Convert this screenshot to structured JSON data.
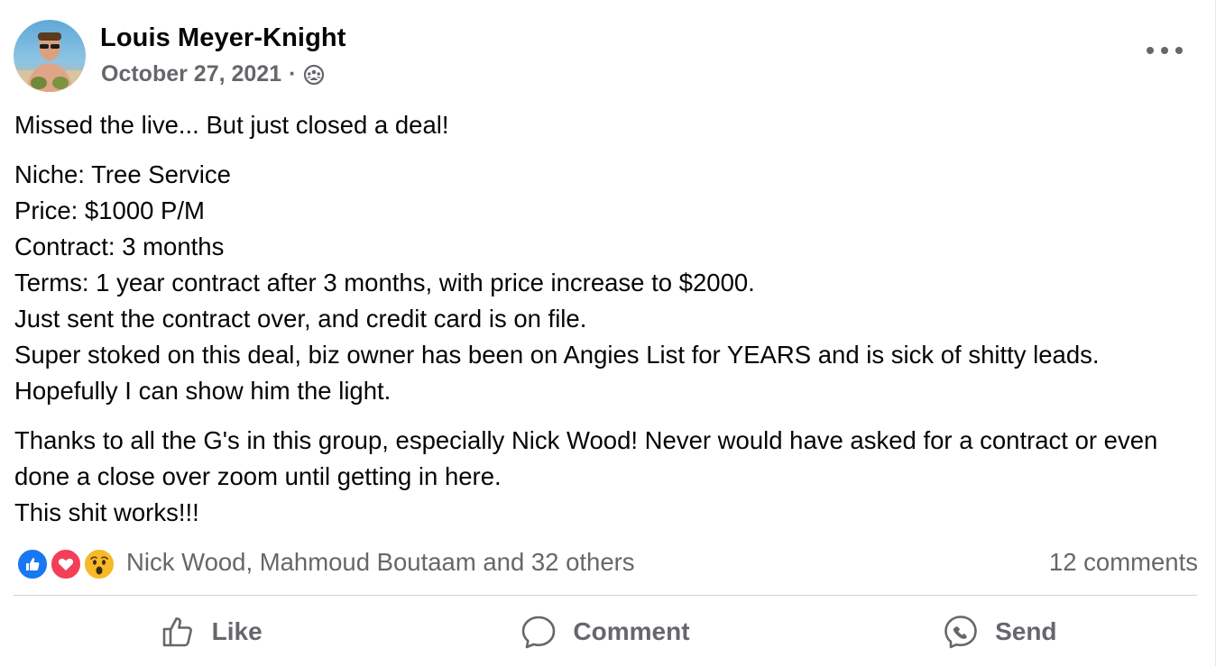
{
  "post": {
    "author": "Louis Meyer-Knight",
    "date": "October 27, 2021",
    "separator": "·",
    "privacy_icon": "group-audience-icon",
    "paragraphs": [
      [
        "Missed the live... But just closed a deal!"
      ],
      [
        "Niche: Tree Service",
        "Price: $1000 P/M",
        "Contract: 3 months",
        "Terms: 1 year contract after 3 months, with price increase to $2000.",
        "Just sent the contract over, and credit card is on file.",
        "Super stoked on this deal, biz owner has been on Angies List for YEARS and is sick of shitty leads. Hopefully I can show him the light."
      ],
      [
        "Thanks to all the G's in this group, especially Nick Wood! Never would have asked for a contract or even done a close over zoom until getting in here.",
        "This shit works!!!"
      ]
    ]
  },
  "engagement": {
    "reaction_icons": [
      "like-reaction-icon",
      "love-reaction-icon",
      "wow-reaction-icon"
    ],
    "reaction_names": "Nick Wood, Mahmoud Boutaam and 32 others",
    "comments": "12 comments"
  },
  "actions": {
    "like": "Like",
    "comment": "Comment",
    "send": "Send"
  },
  "colors": {
    "text": "#050505",
    "secondary": "#65676b",
    "like_blue": "#1877f2",
    "love_red": "#f33e58",
    "wow_yellow": "#f7b928"
  }
}
